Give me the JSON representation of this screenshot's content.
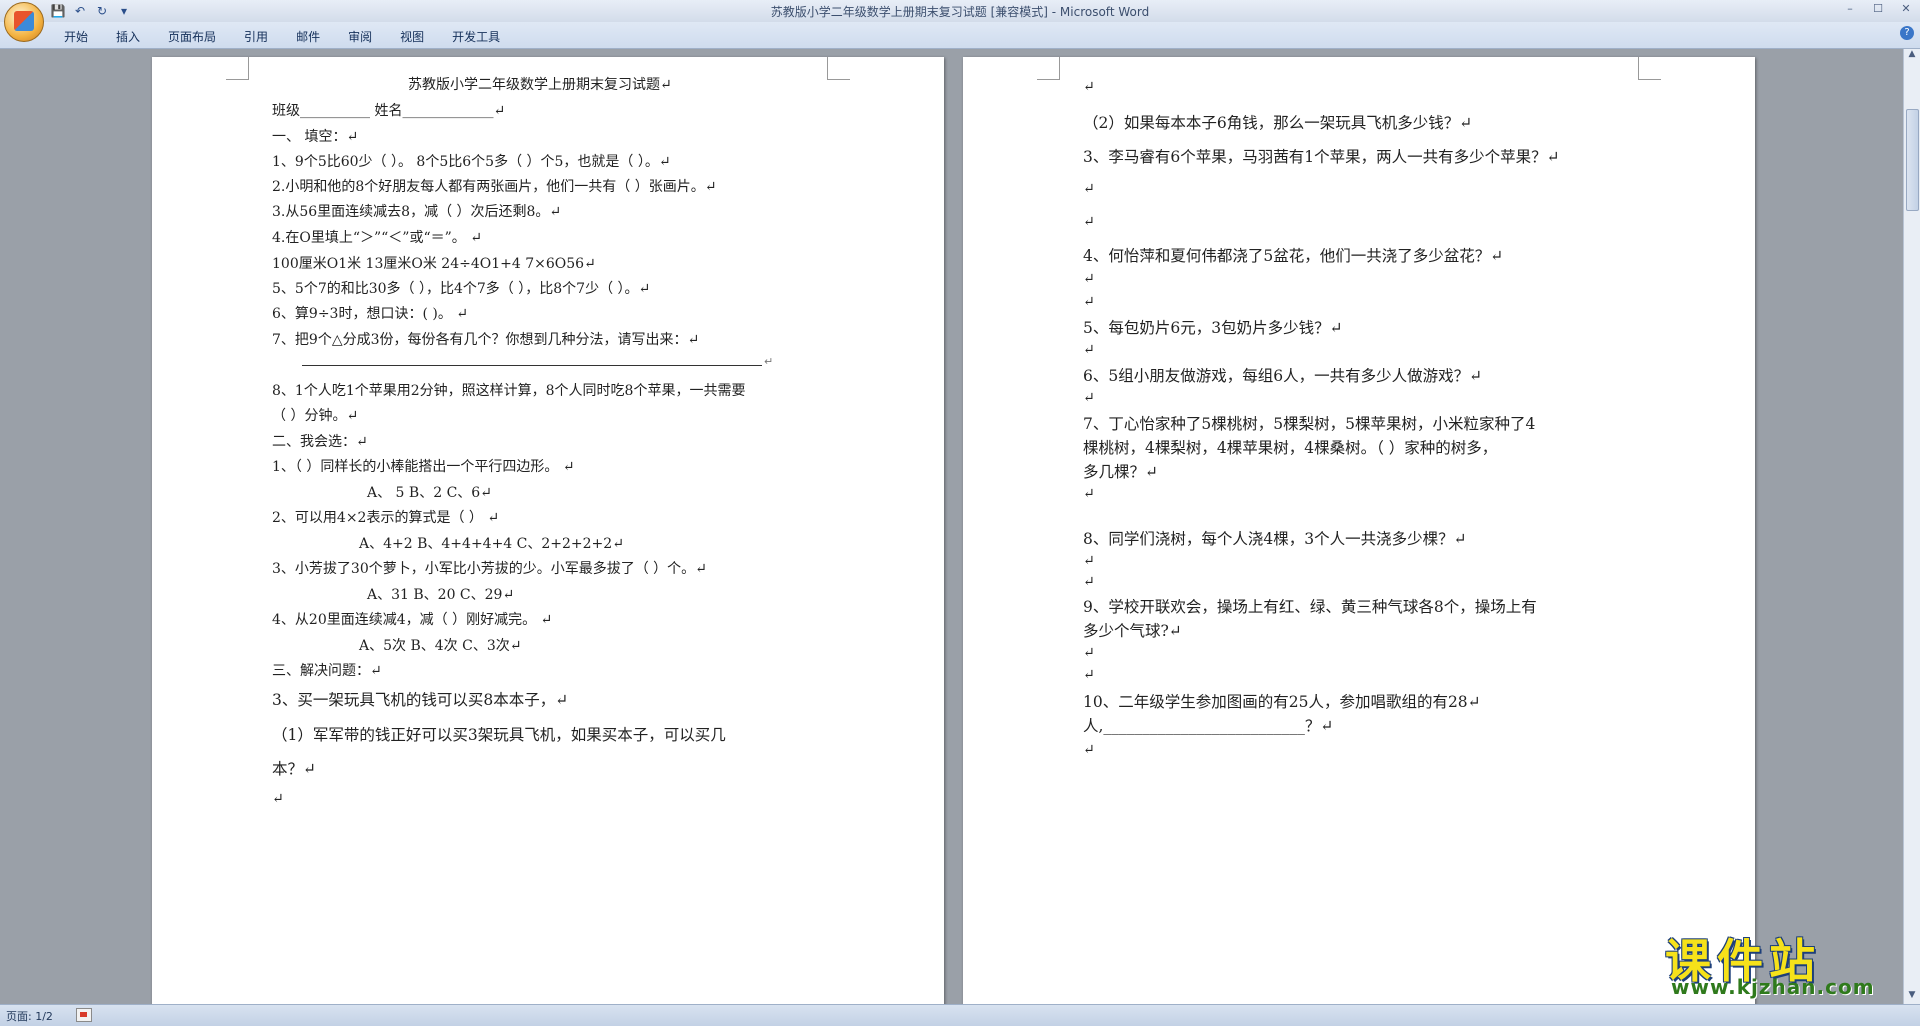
{
  "window": {
    "title": "苏教版小学二年级数学上册期末复习试题 [兼容模式] - Microsoft Word",
    "quick_access": [
      "save-icon",
      "undo-icon",
      "redo-icon",
      "customize-icon"
    ]
  },
  "ribbon": {
    "tabs": [
      "开始",
      "插入",
      "页面布局",
      "引用",
      "邮件",
      "审阅",
      "视图",
      "开发工具"
    ]
  },
  "left_page": {
    "lines": [
      "苏教版小学二年级数学上册期末复习试题↵",
      "班级__________          姓名_____________↵",
      "一、      填空：↵",
      "1、9个5比60少（          ）。      8个5比6个5多（    ）个5，也就是（    ）。↵",
      "2.小明和他的8个好朋友每人都有两张画片，他们一共有（          ）张画片。↵",
      "3.从56里面连续减去8，减（        ）次后还剩8。↵",
      "4.在O里填上“＞”“＜”或“＝”。      ↵",
      "   100厘米O1米            13厘米O米                24÷4O1+4            7×6O56↵",
      "5、5个7的和比30多（    ），比4个7多（    ），比8个7少（    ）。↵",
      "6、算9÷3时，想口诀：(                      )。          ↵",
      "7、把9个△分成3份，每份各有几个？你想到几种分法，请写出来：↵",
      "8、1个人吃1个苹果用2分钟，照这样计算，8个人同时吃8个苹果，一共需要",
      "（    ）分钟。↵",
      "二、我会选：↵",
      "1、（            ）同样长的小棒能搭出一个平行四边形。          ↵",
      "A、      5                    B、2          C、6↵",
      "2、可以用4×2表示的算式是（                                                    ）       ↵",
      "A、4+2          B、4+4+4+4            C、2+2+2+2↵",
      "3、小芳拔了30个萝卜，小军比小芳拔的少。小军最多拔了（                ）个。↵",
      "A、31            B、20      C、29↵",
      "4、从20里面连续减4，减（                        ）刚好减完。      ↵",
      "A、5次          B、4次                  C、3次↵",
      "三、解决问题：↵",
      "3、买一架玩具飞机的钱可以买8本本子，↵",
      "（1）军军带的钱正好可以买3架玩具飞机，如果买本子，可以买几",
      "本？↵",
      "↵"
    ]
  },
  "right_page": {
    "lines": [
      "↵",
      "（2）如果每本本子6角钱，那么一架玩具飞机多少钱？↵",
      "3、李马睿有6个苹果，马羽茜有1个苹果，两人一共有多少个苹果？↵",
      "↵",
      "↵",
      "4、何怡萍和夏何伟都浇了5盆花，他们一共浇了多少盆花？↵",
      "↵",
      "↵",
      "5、每包奶片6元，3包奶片多少钱？↵",
      "↵",
      "6、5组小朋友做游戏，每组6人，一共有多少人做游戏？↵",
      "↵",
      "7、丁心怡家种了5棵桃树，5棵梨树，5棵苹果树，小米粒家种了4",
      "棵桃树，4棵梨树，4棵苹果树，4棵桑树。（          ）家种的树多，",
      "多几棵？↵",
      "↵",
      "8、同学们浇树，每个人浇4棵，3个人一共浇多少棵？↵",
      "↵",
      "↵",
      "9、学校开联欢会，操场上有红、绿、黄三种气球各8个，操场上有",
      "多少个气球?↵",
      "↵",
      "↵",
      "10、二年级学生参加图画的有25人，参加唱歌组的有28↵",
      "人,__________________________？↵",
      "↵"
    ]
  },
  "status": {
    "page": "页面: 1/2"
  },
  "watermark": {
    "brand": "课件站",
    "url": "www.kjzhan.com"
  }
}
